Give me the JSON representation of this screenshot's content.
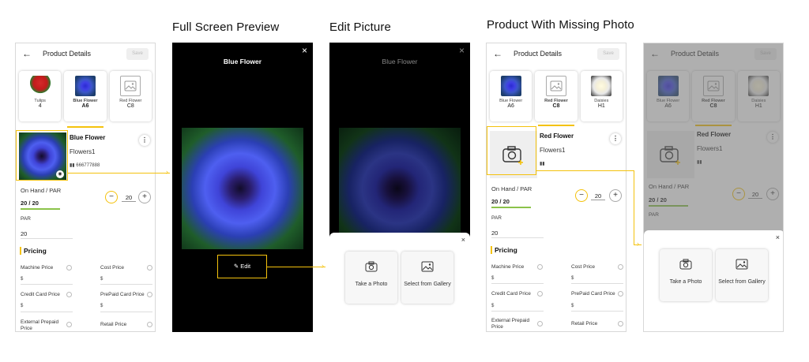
{
  "headings": {
    "full_screen": "Full Screen Preview",
    "edit_picture": "Edit Picture",
    "missing_photo": "Product With Missing Photo"
  },
  "details": {
    "title": "Product Details",
    "save": "Save",
    "back_icon": "←"
  },
  "cards1": [
    {
      "name": "Tulips",
      "code": "4",
      "icon": "red-tulip-image"
    },
    {
      "name": "Blue Flower",
      "code": "A6",
      "icon": "blue-flower-image"
    },
    {
      "name": "Red Flower",
      "code": "C8",
      "icon": "image-placeholder-icon"
    }
  ],
  "cards2": [
    {
      "name": "Blue Flower",
      "code": "A6",
      "icon": "blue-flower-image"
    },
    {
      "name": "Red Flower",
      "code": "C8",
      "icon": "image-placeholder-icon"
    },
    {
      "name": "Daisies",
      "code": "H1",
      "icon": "daisies-image"
    }
  ],
  "product1": {
    "name": "Blue Flower",
    "category": "Flowers1",
    "barcode": "666777888"
  },
  "product2": {
    "name": "Red Flower",
    "category": "Flowers1",
    "barcode": ""
  },
  "inventory": {
    "on_hand_label": "On Hand / PAR",
    "on_hand_value": "20 / 20",
    "stepper_value": "20",
    "minus": "−",
    "plus": "+",
    "par_label": "PAR",
    "par_value": "20"
  },
  "pricing": {
    "title": "Pricing",
    "machine": "Machine Price",
    "cost": "Cost Price",
    "credit": "Credit Card Price",
    "prepaid": "PrePaid Card Price",
    "external": "External Prepaid Price",
    "retail": "Retail Price"
  },
  "preview": {
    "title": "Blue Flower",
    "edit": "Edit",
    "close": "×"
  },
  "modal": {
    "take_photo": "Take a Photo",
    "gallery": "Select from Gallery",
    "close": "×"
  },
  "colors": {
    "accent": "#f4c20d",
    "bar": "#8bc34a"
  }
}
